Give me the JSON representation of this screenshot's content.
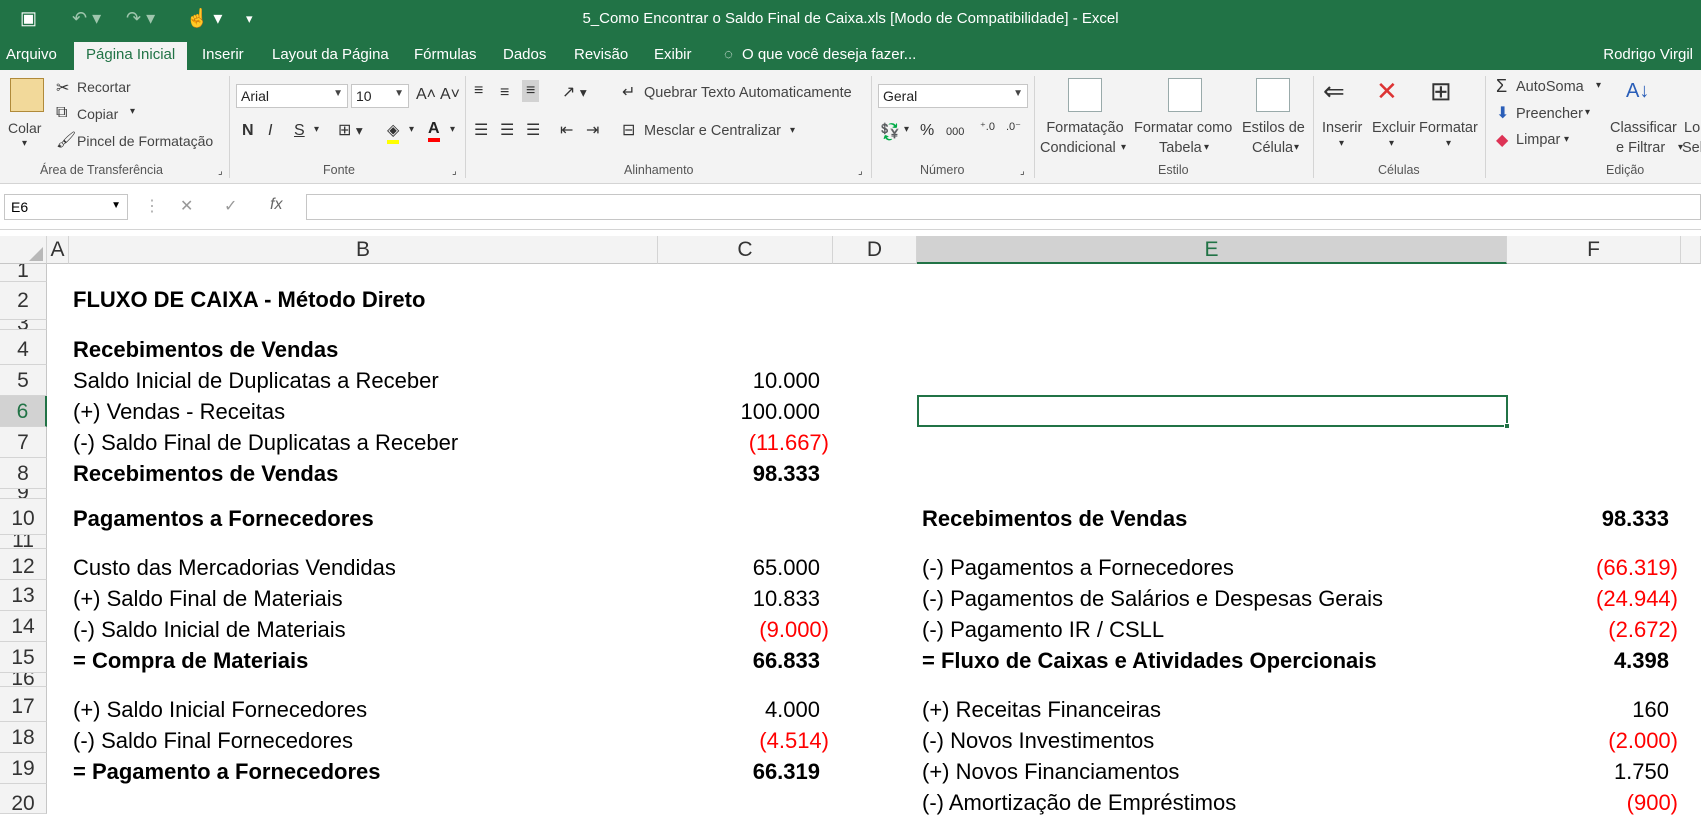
{
  "window": {
    "title": "5_Como Encontrar o Saldo Final de Caixa.xls  [Modo de Compatibilidade] - Excel",
    "user": "Rodrigo Virgil"
  },
  "tabs": [
    "Arquivo",
    "Página Inicial",
    "Inserir",
    "Layout da Página",
    "Fórmulas",
    "Dados",
    "Revisão",
    "Exibir"
  ],
  "tellme": "O que você deseja fazer...",
  "ribbon": {
    "clipboard": {
      "paste": "Colar",
      "cut": "Recortar",
      "copy": "Copiar",
      "format_painter": "Pincel de Formatação",
      "group": "Área de Transferência"
    },
    "font": {
      "name": "Arial",
      "size": "10",
      "group": "Fonte",
      "bold": "N",
      "italic": "I",
      "underline": "S"
    },
    "alignment": {
      "wrap": "Quebrar Texto Automaticamente",
      "merge": "Mesclar e Centralizar",
      "group": "Alinhamento"
    },
    "number": {
      "format": "Geral",
      "percent": "%",
      "thousands": "000",
      "group": "Número"
    },
    "styles": {
      "cond": [
        "Formatação",
        "Condicional"
      ],
      "table": [
        "Formatar como",
        "Tabela"
      ],
      "cell": [
        "Estilos de",
        "Célula"
      ],
      "group": "Estilo"
    },
    "cells": {
      "insert": "Inserir",
      "delete": "Excluir",
      "format": "Formatar",
      "group": "Células"
    },
    "editing": {
      "autosum": "AutoSoma",
      "fill": "Preencher",
      "clear": "Limpar",
      "sort": [
        "Classificar",
        "e Filtrar"
      ],
      "find": [
        "Lo",
        "Sel"
      ],
      "group": "Edição"
    }
  },
  "formula_bar": {
    "name_box": "E6",
    "fx": "fx",
    "content": ""
  },
  "columns": [
    "A",
    "B",
    "C",
    "D",
    "E",
    "F"
  ],
  "rows": [
    "1",
    "2",
    "3",
    "4",
    "5",
    "6",
    "7",
    "8",
    "9",
    "10",
    "11",
    "12",
    "13",
    "14",
    "15",
    "16",
    "17",
    "18",
    "19",
    "20"
  ],
  "left_block": {
    "title": "FLUXO DE CAIXA - Método Direto",
    "items": [
      {
        "label": "Recebimentos de Vendas",
        "value": "",
        "bold": true,
        "neg": false
      },
      {
        "label": "Saldo Inicial de Duplicatas a Receber",
        "value": "10.000",
        "bold": false,
        "neg": false
      },
      {
        "label": "(+) Vendas - Receitas",
        "value": "100.000",
        "bold": false,
        "neg": false
      },
      {
        "label": "(-) Saldo Final de Duplicatas a Receber",
        "value": "(11.667)",
        "bold": false,
        "neg": true
      },
      {
        "label": "Recebimentos de Vendas",
        "value": "98.333",
        "bold": true,
        "neg": false
      },
      {
        "label": "Pagamentos a Fornecedores",
        "value": "",
        "bold": true,
        "neg": false
      },
      {
        "label": "Custo das Mercadorias Vendidas",
        "value": "65.000",
        "bold": false,
        "neg": false
      },
      {
        "label": "(+) Saldo Final de Materiais",
        "value": "10.833",
        "bold": false,
        "neg": false
      },
      {
        "label": "(-) Saldo Inicial de Materiais",
        "value": "(9.000)",
        "bold": false,
        "neg": true
      },
      {
        "label": "= Compra de Materiais",
        "value": "66.833",
        "bold": true,
        "neg": false
      },
      {
        "label": "(+) Saldo Inicial Fornecedores",
        "value": "4.000",
        "bold": false,
        "neg": false
      },
      {
        "label": "(-) Saldo Final Fornecedores",
        "value": "(4.514)",
        "bold": false,
        "neg": true
      },
      {
        "label": "= Pagamento a Fornecedores",
        "value": "66.319",
        "bold": true,
        "neg": false
      }
    ]
  },
  "right_block": {
    "items": [
      {
        "label": "Recebimentos de Vendas",
        "value": "98.333",
        "bold": true,
        "neg": false
      },
      {
        "label": "(-) Pagamentos a Fornecedores",
        "value": "(66.319)",
        "bold": false,
        "neg": true
      },
      {
        "label": "(-) Pagamentos de Salários e Despesas Gerais",
        "value": "(24.944)",
        "bold": false,
        "neg": true
      },
      {
        "label": "(-) Pagamento IR / CSLL",
        "value": "(2.672)",
        "bold": false,
        "neg": true
      },
      {
        "label": "= Fluxo de Caixas e Atividades Opercionais",
        "value": "4.398",
        "bold": true,
        "neg": false
      },
      {
        "label": "(+) Receitas Financeiras",
        "value": "160",
        "bold": false,
        "neg": false
      },
      {
        "label": "(-) Novos Investimentos",
        "value": "(2.000)",
        "bold": false,
        "neg": true
      },
      {
        "label": "(+) Novos Financiamentos",
        "value": "1.750",
        "bold": false,
        "neg": false
      },
      {
        "label": "(-) Amortização de Empréstimos",
        "value": "(900)",
        "bold": false,
        "neg": true
      }
    ]
  },
  "colors": {
    "excel_green": "#217346",
    "negative": "#ff0000"
  }
}
